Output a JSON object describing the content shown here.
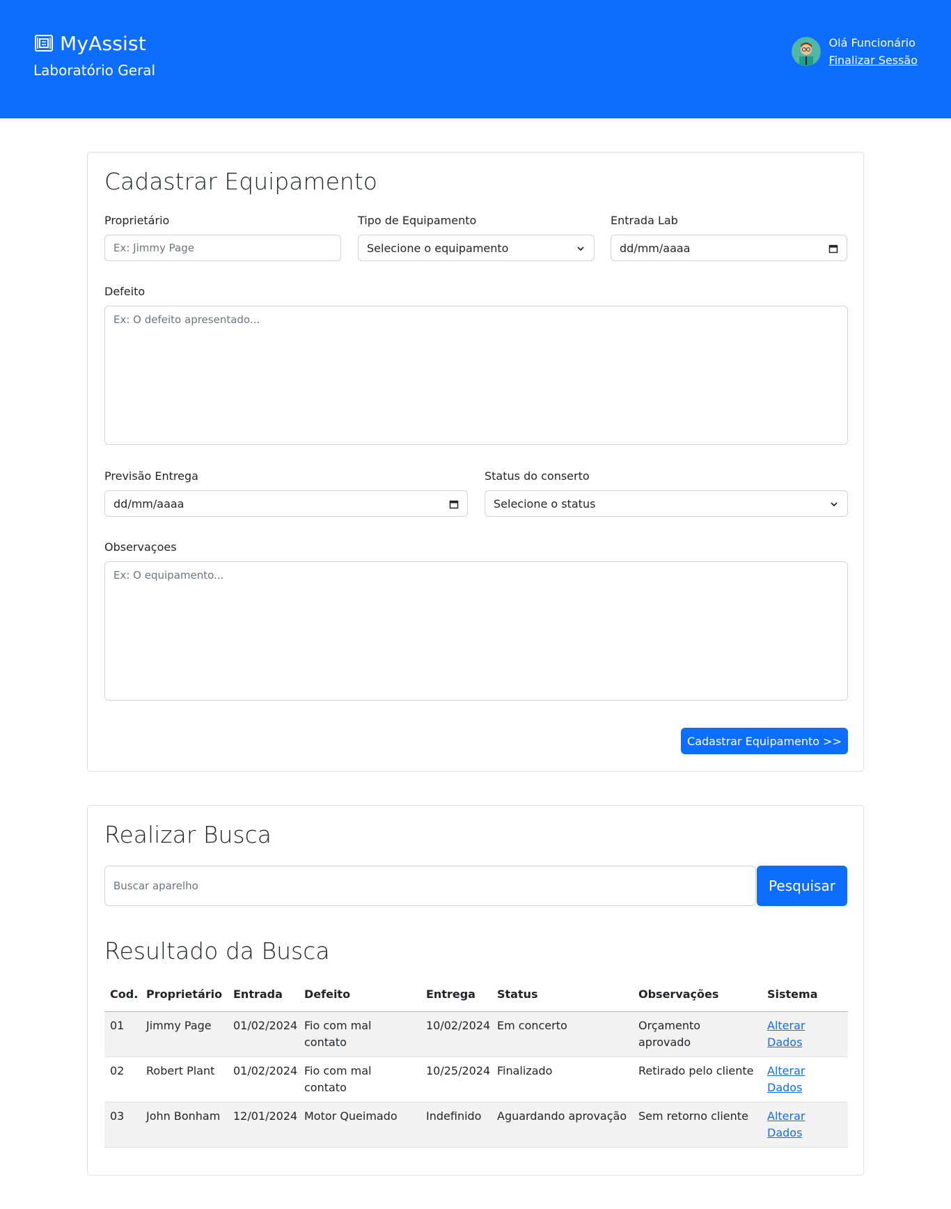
{
  "header": {
    "brand": "MyAssist",
    "subtitle": "Laboratório Geral",
    "greeting": "Olá Funcionário",
    "logout": "Finalizar Sessão",
    "bg_color": "#0d6efd"
  },
  "register_form": {
    "title": "Cadastrar Equipamento",
    "owner_label": "Proprietário",
    "owner_placeholder": "Ex: Jimmy Page",
    "type_label": "Tipo de Equipamento",
    "type_value": "Selecione o equipamento",
    "entry_label": "Entrada Lab",
    "entry_value": "dd/mm/aaaa",
    "defect_label": "Defeito",
    "defect_placeholder": "Ex: O defeito apresentado...",
    "delivery_label": "Previsão Entrega",
    "delivery_value": "dd/mm/aaaa",
    "status_label": "Status do conserto",
    "status_value": "Selecione o status",
    "notes_label": "Observaçoes",
    "notes_placeholder": "Ex: O equipamento...",
    "submit_label": "Cadastrar Equipamento >>"
  },
  "search": {
    "title": "Realizar Busca",
    "placeholder": "Buscar aparelho",
    "button": "Pesquisar",
    "results_title": "Resultado da Busca"
  },
  "results": {
    "columns": [
      "Cod.",
      "Proprietário",
      "Entrada",
      "Defeito",
      "Entrega",
      "Status",
      "Observações",
      "Sistema"
    ],
    "rows": [
      {
        "cod": "01",
        "owner": "Jimmy Page",
        "entry": "01/02/2024",
        "defect": "Fio com mal contato",
        "delivery": "10/02/2024",
        "status": "Em concerto",
        "notes": "Orçamento aprovado",
        "action": "Alterar Dados"
      },
      {
        "cod": "02",
        "owner": "Robert Plant",
        "entry": "01/02/2024",
        "defect": "Fio com mal contato",
        "delivery": "10/25/2024",
        "status": "Finalizado",
        "notes": "Retirado pelo cliente",
        "action": "Alterar Dados"
      },
      {
        "cod": "03",
        "owner": "John Bonham",
        "entry": "12/01/2024",
        "defect": "Motor Queimado",
        "delivery": "Indefinido",
        "status": "Aguardando aprovação",
        "notes": "Sem retorno cliente",
        "action": "Alterar Dados"
      }
    ]
  },
  "icons": {
    "brand": "laptop-chip-icon",
    "avatar": "user-avatar-icon",
    "select": "chevron-down-icon",
    "date": "calendar-icon"
  }
}
